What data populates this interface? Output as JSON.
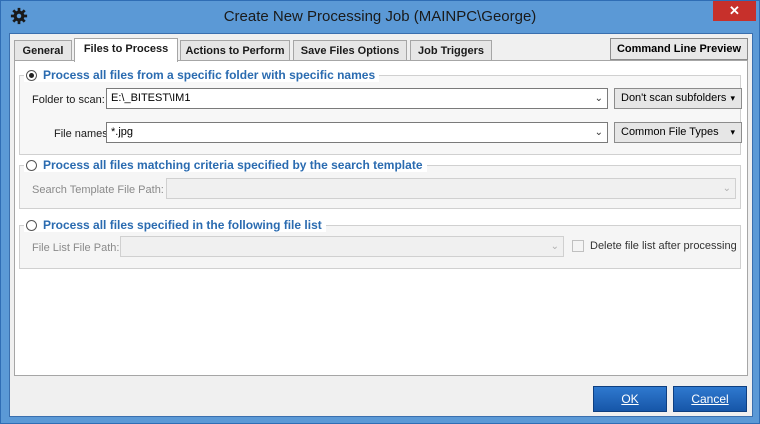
{
  "window": {
    "title": "Create New Processing Job (MAINPC\\George)",
    "close_symbol": "✕"
  },
  "tabs": [
    {
      "label": "General"
    },
    {
      "label": "Files to Process"
    },
    {
      "label": "Actions to Perform"
    },
    {
      "label": "Save Files Options"
    },
    {
      "label": "Job Triggers"
    }
  ],
  "command_line_preview": "Command Line Preview",
  "specific_folder": {
    "title": "Process all files from a specific folder with specific names",
    "folder_label": "Folder to scan:",
    "folder_value": "E:\\_BITEST\\IM1",
    "subfolders_option": "Don't scan subfolders",
    "names_label": "File names:",
    "names_value": "*.jpg",
    "file_types_button": "Common File Types"
  },
  "search_template": {
    "title": "Process all files matching criteria specified by the search template",
    "path_label": "Search Template File Path:"
  },
  "file_list": {
    "title": "Process all files specified in the following file list",
    "path_label": "File List File Path:",
    "delete_label": "Delete file list after processing"
  },
  "buttons": {
    "ok": "OK",
    "cancel": "Cancel"
  },
  "icons": {
    "arrow_down": "⌄",
    "dropdown_triangle": "▾"
  }
}
